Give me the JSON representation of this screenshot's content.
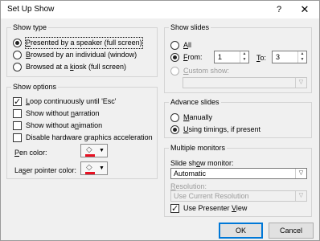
{
  "dialog": {
    "title": "Set Up Show",
    "help": "?",
    "close": "✕"
  },
  "show_type": {
    "legend": "Show type",
    "options": [
      {
        "label_pre": "",
        "key": "P",
        "label_post": "resented by a speaker (full screen)",
        "checked": true
      },
      {
        "label_pre": "",
        "key": "B",
        "label_post": "rowsed by an individual (window)",
        "checked": false
      },
      {
        "label_pre": "Browsed at a ",
        "key": "k",
        "label_post": "iosk (full screen)",
        "checked": false
      }
    ]
  },
  "show_options": {
    "legend": "Show options",
    "checks": [
      {
        "label_pre": "",
        "key": "L",
        "label_post": "oop continuously until 'Esc'",
        "checked": true
      },
      {
        "label_pre": "Show without ",
        "key": "n",
        "label_post": "arration",
        "checked": false
      },
      {
        "label_pre": "Show without a",
        "key": "n",
        "label_post": "imation",
        "checked": false
      },
      {
        "label_pre": "Disable hardware ",
        "key": "g",
        "label_post": "raphics acceleration",
        "checked": false
      }
    ],
    "pen_color": {
      "label_pre": "",
      "key": "P",
      "label_post": "en color:",
      "color": "#e81123"
    },
    "laser_color": {
      "label_pre": "La",
      "key": "s",
      "label_post": "er pointer color:",
      "color": "#e81123"
    }
  },
  "show_slides": {
    "legend": "Show slides",
    "all": {
      "label_pre": "",
      "key": "A",
      "label_post": "ll",
      "checked": false
    },
    "from": {
      "label_pre": "",
      "key": "F",
      "label_post": "rom:",
      "checked": true,
      "value": "1"
    },
    "to": {
      "label_pre": "",
      "key": "T",
      "label_post": "o:",
      "value": "3"
    },
    "custom": {
      "label_pre": "",
      "key": "C",
      "label_post": "ustom show:",
      "checked": false,
      "value": ""
    }
  },
  "advance_slides": {
    "legend": "Advance slides",
    "manual": {
      "label_pre": "",
      "key": "M",
      "label_post": "anually",
      "checked": false
    },
    "timings": {
      "label_pre": "",
      "key": "U",
      "label_post": "sing timings, if present",
      "checked": true
    }
  },
  "monitors": {
    "legend": "Multiple monitors",
    "slide_show_monitor": {
      "label_pre": "Slide sh",
      "key": "o",
      "label_post": "w monitor:",
      "value": "Automatic"
    },
    "resolution": {
      "label_pre": "",
      "key": "R",
      "label_post": "esolution:",
      "value": "Use Current Resolution"
    },
    "presenter_view": {
      "label_pre": "Use Presenter ",
      "key": "V",
      "label_post": "iew",
      "checked": true
    }
  },
  "buttons": {
    "ok": "OK",
    "cancel": "Cancel"
  }
}
